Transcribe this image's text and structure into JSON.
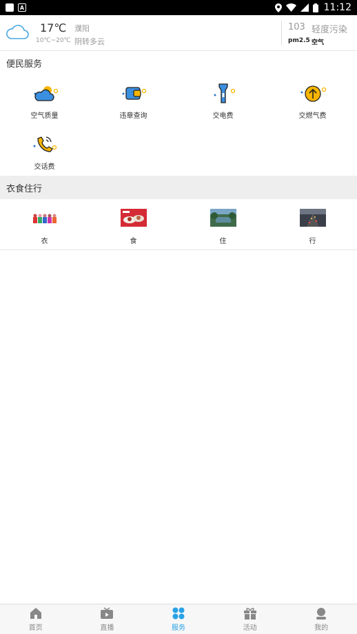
{
  "status_bar": {
    "time": "11:12"
  },
  "weather": {
    "temperature": "17℃",
    "temp_range": "10℃~20℃",
    "city": "濮阳",
    "condition": "阴转多云",
    "aqi_value": "103",
    "aqi_level": "轻度污染",
    "pm_label": "pm2.5",
    "air_label": "空气"
  },
  "services": {
    "title": "便民服务",
    "items": [
      {
        "label": "空气质量",
        "icon": "cloud-icon"
      },
      {
        "label": "违章查询",
        "icon": "wallet-icon"
      },
      {
        "label": "交电费",
        "icon": "flashlight-icon"
      },
      {
        "label": "交燃气费",
        "icon": "arrow-up-circle-icon"
      },
      {
        "label": "交话费",
        "icon": "phone-icon"
      }
    ]
  },
  "life": {
    "title": "衣食住行",
    "items": [
      {
        "label": "衣",
        "icon": "clothing-photo"
      },
      {
        "label": "食",
        "icon": "food-photo"
      },
      {
        "label": "住",
        "icon": "housing-photo"
      },
      {
        "label": "行",
        "icon": "traffic-photo"
      }
    ]
  },
  "tabbar": {
    "items": [
      {
        "label": "首页",
        "icon": "home-icon"
      },
      {
        "label": "直播",
        "icon": "tv-icon"
      },
      {
        "label": "服务",
        "icon": "services-icon",
        "active": true
      },
      {
        "label": "活动",
        "icon": "gift-icon"
      },
      {
        "label": "我的",
        "icon": "profile-icon"
      }
    ]
  },
  "colors": {
    "accent": "#2aa2e6",
    "icon_yellow": "#f7b500",
    "icon_blue": "#2a79c9"
  }
}
